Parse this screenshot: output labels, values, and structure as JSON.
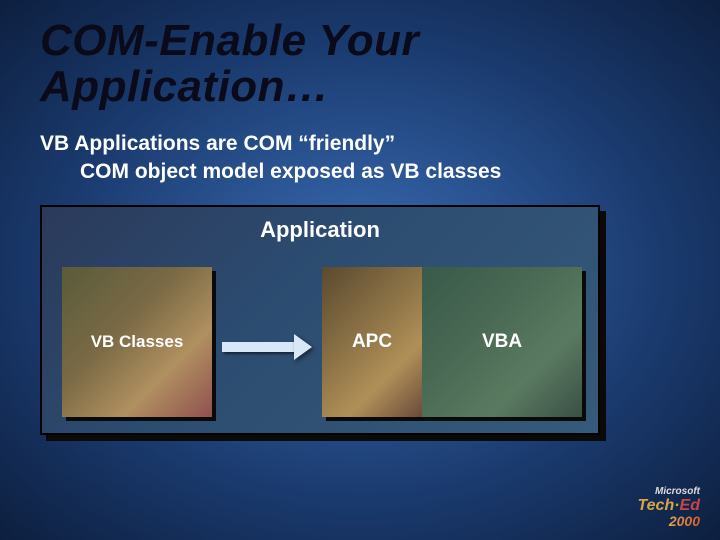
{
  "title": "COM-Enable Your Application…",
  "body": {
    "line1": "VB Applications are COM “friendly”",
    "line2": "COM object model exposed as VB classes"
  },
  "diagram": {
    "app_label": "Application",
    "boxes": {
      "vb_classes": "VB Classes",
      "apc": "APC",
      "vba": "VBA"
    }
  },
  "logo": {
    "vendor": "Microsoft",
    "brand_part1": "Tech·",
    "brand_part2": "Ed",
    "year": "2000"
  }
}
